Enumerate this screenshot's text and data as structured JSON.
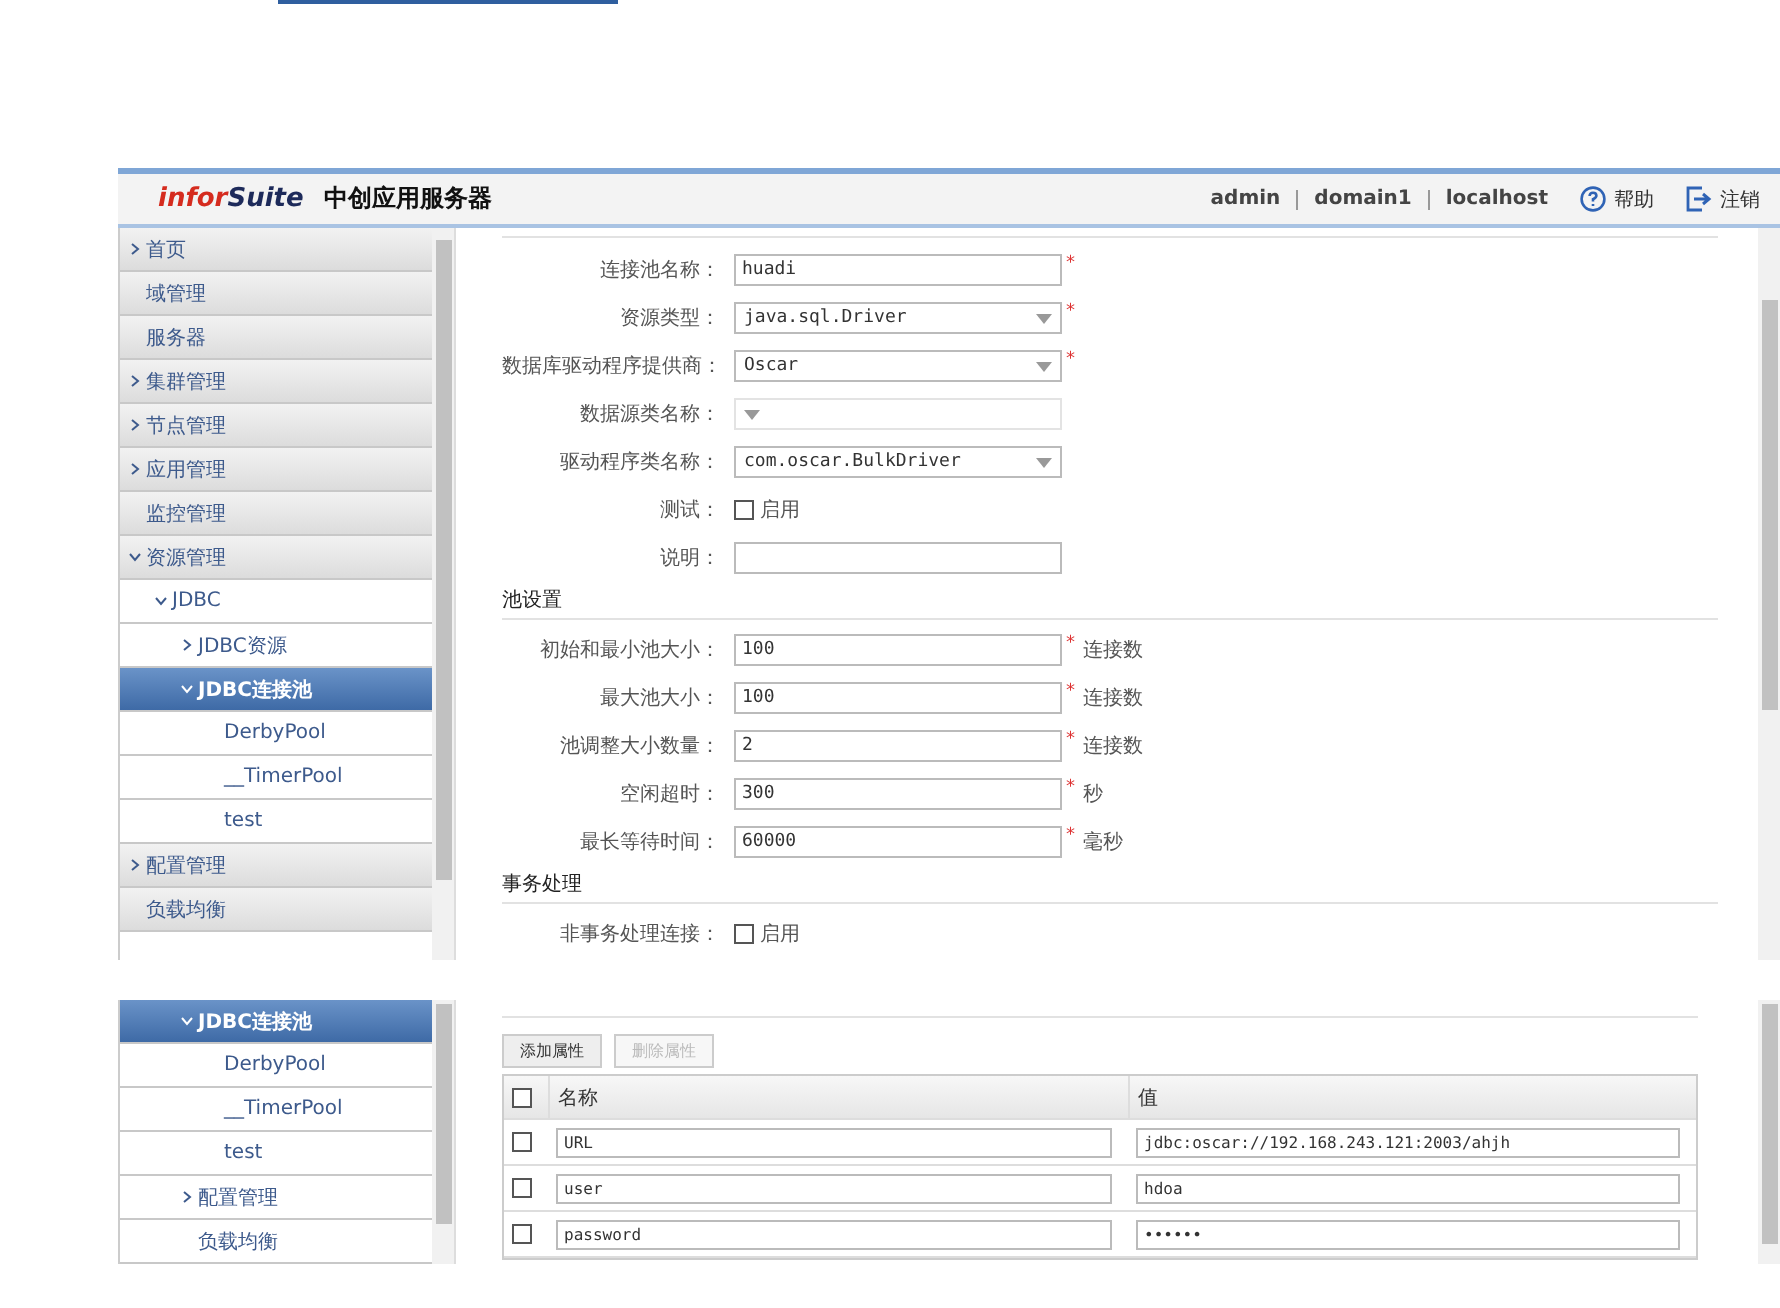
{
  "main_window": {
    "header": {
      "logo_prefix": "infor",
      "logo_suffix": "Suite",
      "product": "中创应用服务器",
      "user": "admin",
      "domain": "domain1",
      "host": "localhost",
      "help": "帮助",
      "logout": "注销"
    },
    "sidebar": [
      {
        "label": "首页",
        "expanded": false,
        "selected": false
      },
      {
        "label": "域管理",
        "selected": false
      },
      {
        "label": "服务器",
        "selected": false
      },
      {
        "label": "集群管理",
        "expanded": false,
        "selected": false
      },
      {
        "label": "节点管理",
        "expanded": false,
        "selected": false
      },
      {
        "label": "应用管理",
        "expanded": false,
        "selected": false
      },
      {
        "label": "监控管理",
        "selected": false
      },
      {
        "label": "资源管理",
        "expanded": true,
        "selected": false,
        "children": [
          {
            "label": "JDBC",
            "expanded": true,
            "selected": false,
            "children": [
              {
                "label": "JDBC资源",
                "expanded": false,
                "selected": false
              },
              {
                "label": "JDBC连接池",
                "expanded": true,
                "selected": true,
                "children": [
                  {
                    "label": "DerbyPool",
                    "selected": false
                  },
                  {
                    "label": "__TimerPool",
                    "selected": false
                  },
                  {
                    "label": "test",
                    "selected": false
                  }
                ]
              }
            ]
          }
        ]
      },
      {
        "label": "配置管理",
        "expanded": false,
        "selected": false
      },
      {
        "label": "负载均衡",
        "selected": false
      }
    ],
    "form": [
      {
        "kind": "text",
        "label": "连接池名称：",
        "value": "huadi",
        "required_mark": "*",
        "disabled": false
      },
      {
        "kind": "select",
        "label": "资源类型：",
        "value": "java.sql.Driver",
        "required_mark": "*",
        "disabled": false
      },
      {
        "kind": "select",
        "label": "数据库驱动程序提供商：",
        "value": "Oscar",
        "required_mark": "*",
        "disabled": false
      },
      {
        "kind": "select",
        "label": "数据源类名称：",
        "disabled": true
      },
      {
        "kind": "select",
        "label": "驱动程序类名称：",
        "value": "com.oscar.BulkDriver",
        "disabled": false
      },
      {
        "kind": "checkbox",
        "label": "测试：",
        "option": "启用",
        "checked": false
      },
      {
        "kind": "text",
        "label": "说明：",
        "disabled": false
      },
      {
        "kind": "section",
        "label": "池设置"
      },
      {
        "kind": "text",
        "label": "初始和最小池大小：",
        "value": "100",
        "required_mark": "*",
        "unit": "连接数",
        "disabled": false
      },
      {
        "kind": "text",
        "label": "最大池大小：",
        "value": "100",
        "required_mark": "*",
        "unit": "连接数",
        "disabled": false
      },
      {
        "kind": "text",
        "label": "池调整大小数量：",
        "value": "2",
        "required_mark": "*",
        "unit": "连接数",
        "disabled": false
      },
      {
        "kind": "text",
        "label": "空闲超时：",
        "value": "300",
        "required_mark": "*",
        "unit": "秒",
        "disabled": false
      },
      {
        "kind": "text",
        "label": "最长等待时间：",
        "value": "60000",
        "required_mark": "*",
        "unit": "毫秒",
        "disabled": false
      },
      {
        "kind": "section",
        "label": "事务处理"
      },
      {
        "kind": "checkbox",
        "label": "非事务处理连接：",
        "option": "启用",
        "checked": false
      }
    ]
  },
  "second_window": {
    "sidebar": [
      {
        "label": "JDBC连接池",
        "expanded": true,
        "selected": true,
        "children": [
          {
            "label": "DerbyPool",
            "selected": false
          },
          {
            "label": "__TimerPool",
            "selected": false
          },
          {
            "label": "test",
            "selected": false
          }
        ]
      },
      {
        "label": "配置管理",
        "expanded": false,
        "selected": false
      },
      {
        "label": "负载均衡",
        "selected": false
      }
    ],
    "buttons": [
      {
        "label": "添加属性",
        "disabled": false
      },
      {
        "label": "删除属性",
        "disabled": true
      }
    ],
    "table": {
      "columns": [
        "名称",
        "值"
      ],
      "all_checked": false,
      "rows": [
        {
          "checked": false,
          "name": "URL",
          "value": "jdbc:oscar://192.168.243.121:2003/ahjh"
        },
        {
          "checked": false,
          "name": "user",
          "value": "hdoa"
        },
        {
          "checked": false,
          "name": "password",
          "value": "••••••"
        }
      ]
    }
  }
}
